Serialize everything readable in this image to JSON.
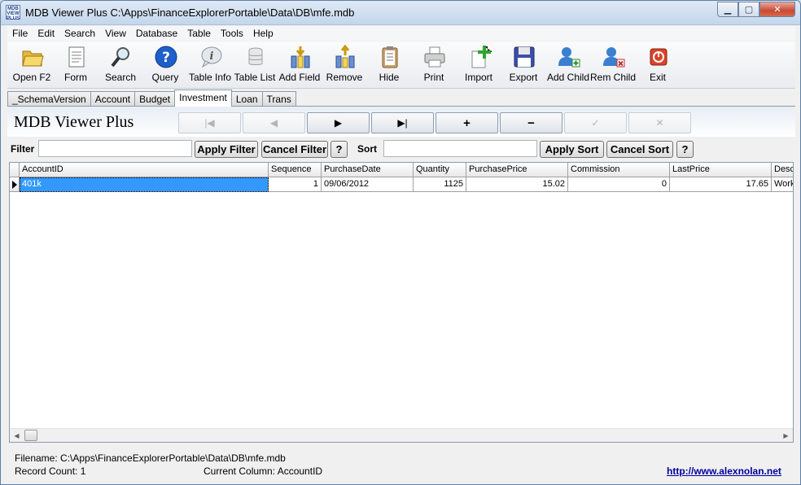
{
  "window": {
    "title": "MDB Viewer Plus C:\\Apps\\FinanceExplorerPortable\\Data\\DB\\mfe.mdb",
    "icon_text": "MDB VIEWER PLUS"
  },
  "menu": [
    {
      "label": "File"
    },
    {
      "label": "Edit"
    },
    {
      "label": "Search"
    },
    {
      "label": "View"
    },
    {
      "label": "Database"
    },
    {
      "label": "Table"
    },
    {
      "label": "Tools"
    },
    {
      "label": "Help"
    }
  ],
  "toolbar": [
    {
      "label": "Open F2",
      "icon": "folder-icon"
    },
    {
      "label": "Form",
      "icon": "form-icon"
    },
    {
      "label": "Search",
      "icon": "magnifier-icon"
    },
    {
      "label": "Query",
      "icon": "question-icon"
    },
    {
      "label": "Table Info",
      "icon": "info-icon"
    },
    {
      "label": "Table List",
      "icon": "database-icon"
    },
    {
      "label": "Add Field",
      "icon": "add-field-icon"
    },
    {
      "label": "Remove",
      "icon": "remove-field-icon"
    },
    {
      "label": "Hide",
      "icon": "clipboard-icon"
    },
    {
      "label": "Print",
      "icon": "printer-icon"
    },
    {
      "label": "Import",
      "icon": "import-icon"
    },
    {
      "label": "Export",
      "icon": "floppy-icon"
    },
    {
      "label": "Add Child",
      "icon": "add-user-icon"
    },
    {
      "label": "Rem Child",
      "icon": "remove-user-icon"
    },
    {
      "label": "Exit",
      "icon": "power-icon"
    }
  ],
  "tabs": [
    {
      "label": "_SchemaVersion"
    },
    {
      "label": "Account"
    },
    {
      "label": "Budget"
    },
    {
      "label": "Investment",
      "active": true
    },
    {
      "label": "Loan"
    },
    {
      "label": "Trans"
    }
  ],
  "nav": {
    "brand": "MDB Viewer Plus",
    "buttons": [
      {
        "glyph": "|◀",
        "name": "first-record-button",
        "enabled": false
      },
      {
        "glyph": "◀",
        "name": "prior-record-button",
        "enabled": false
      },
      {
        "glyph": "▶",
        "name": "next-record-button",
        "enabled": true
      },
      {
        "glyph": "▶|",
        "name": "last-record-button",
        "enabled": true
      },
      {
        "glyph": "+",
        "name": "insert-record-button",
        "enabled": true
      },
      {
        "glyph": "−",
        "name": "delete-record-button",
        "enabled": true
      },
      {
        "glyph": "✓",
        "name": "post-edit-button",
        "enabled": false
      },
      {
        "glyph": "✕",
        "name": "cancel-edit-button",
        "enabled": false
      }
    ]
  },
  "filter": {
    "label": "Filter",
    "value": "",
    "apply_label": "Apply Filter",
    "cancel_label": "Cancel Filter",
    "help_label": "?"
  },
  "sort": {
    "label": "Sort",
    "value": "",
    "apply_label": "Apply Sort",
    "cancel_label": "Cancel Sort",
    "help_label": "?"
  },
  "grid": {
    "columns": [
      "AccountID",
      "Sequence",
      "PurchaseDate",
      "Quantity",
      "PurchasePrice",
      "Commission",
      "LastPrice",
      "Desc"
    ],
    "rows": [
      [
        "401k",
        "1",
        "09/06/2012",
        "1125",
        "15.02",
        "0",
        "17.65",
        "Work"
      ]
    ]
  },
  "status": {
    "filename": "Filename: C:\\Apps\\FinanceExplorerPortable\\Data\\DB\\mfe.mdb",
    "record_count": "Record Count: 1",
    "current_column": "Current Column: AccountID",
    "website": "http://www.alexnolan.net"
  }
}
